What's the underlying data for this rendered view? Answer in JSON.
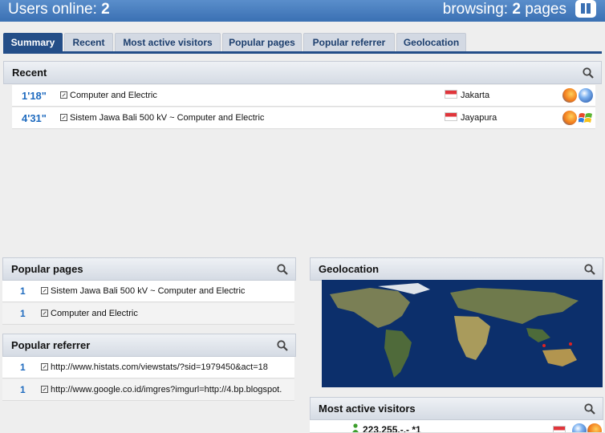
{
  "header": {
    "users_label": "Users online:",
    "users_count": "2",
    "browsing_label": "browsing:",
    "browsing_count": "2",
    "browsing_suffix": "pages"
  },
  "tabs": [
    "Summary",
    "Recent",
    "Most active visitors",
    "Popular pages",
    "Popular referrer",
    "Geolocation"
  ],
  "recent": {
    "title": "Recent",
    "rows": [
      {
        "time": "1'18\"",
        "page": "Computer and Electric",
        "city": "Jakarta"
      },
      {
        "time": "4'31\"",
        "page": "Sistem Jawa Bali 500 kV ~ Computer and Electric",
        "city": "Jayapura"
      }
    ]
  },
  "popular_pages": {
    "title": "Popular pages",
    "rows": [
      {
        "count": "1",
        "page": "Sistem Jawa Bali 500 kV ~ Computer and Electric"
      },
      {
        "count": "1",
        "page": "Computer and Electric"
      }
    ]
  },
  "popular_referrer": {
    "title": "Popular referrer",
    "rows": [
      {
        "count": "1",
        "url": "http://www.histats.com/viewstats/?sid=1979450&act=18"
      },
      {
        "count": "1",
        "url": "http://www.google.co.id/imgres?imgurl=http://4.bp.blogspot."
      }
    ]
  },
  "geolocation": {
    "title": "Geolocation"
  },
  "most_active": {
    "title": "Most active visitors",
    "rows": [
      {
        "ip": "223.255.-.-",
        "visits": "*1"
      }
    ]
  },
  "colors": {
    "accent": "#244e88",
    "link": "#1f6bbf",
    "topbar": "#3a70b3"
  }
}
